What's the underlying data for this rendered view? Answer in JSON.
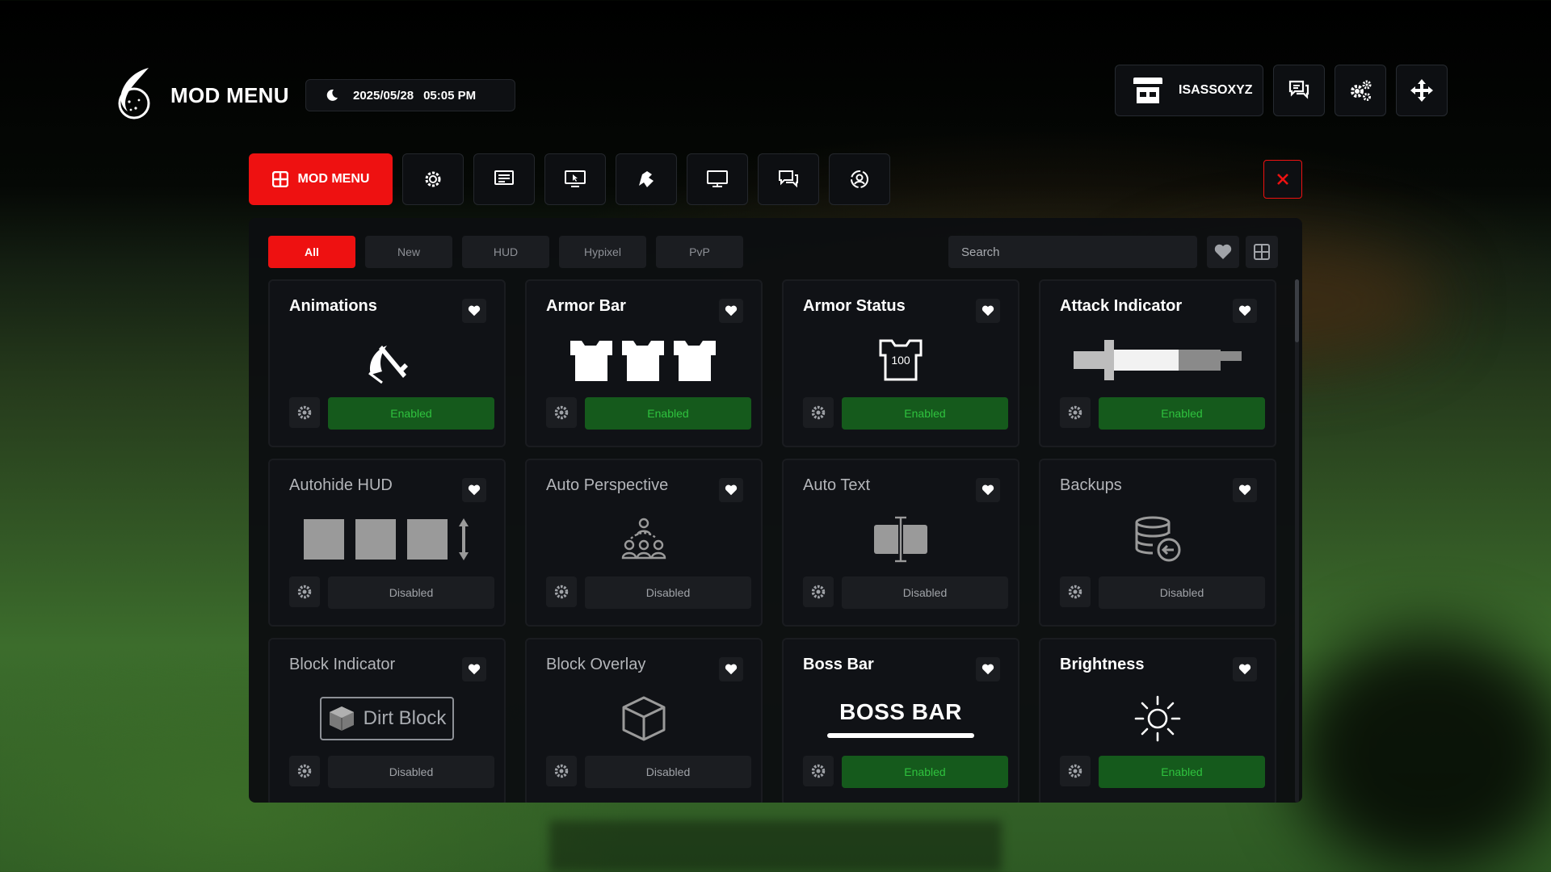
{
  "header": {
    "brand": "MOD MENU",
    "date": "2025/05/28",
    "time": "05:05 PM",
    "username": "ISASSOXYZ"
  },
  "tabs": {
    "main_label": "MOD MENU",
    "icons": [
      "gear-icon",
      "text-icon",
      "screen-mouse-icon",
      "cosmetic-icon",
      "monitor-icon",
      "chat-icon",
      "profile-icon"
    ]
  },
  "filters": [
    "All",
    "New",
    "HUD",
    "Hypixel",
    "PvP"
  ],
  "search": {
    "placeholder": "Search"
  },
  "mods": [
    {
      "name": "Animations",
      "status": "Enabled"
    },
    {
      "name": "Armor Bar",
      "status": "Enabled"
    },
    {
      "name": "Armor Status",
      "status": "Enabled",
      "preview_text": "100"
    },
    {
      "name": "Attack Indicator",
      "status": "Enabled"
    },
    {
      "name": "Autohide HUD",
      "status": "Disabled"
    },
    {
      "name": "Auto Perspective",
      "status": "Disabled"
    },
    {
      "name": "Auto Text",
      "status": "Disabled"
    },
    {
      "name": "Backups",
      "status": "Disabled"
    },
    {
      "name": "Block Indicator",
      "status": "Disabled",
      "preview_text": "Dirt Block"
    },
    {
      "name": "Block Overlay",
      "status": "Disabled"
    },
    {
      "name": "Boss Bar",
      "status": "Enabled",
      "preview_text": "BOSS BAR"
    },
    {
      "name": "Brightness",
      "status": "Enabled"
    }
  ],
  "colors": {
    "accent": "#ee1111",
    "enabled_bg": "#155a1c",
    "enabled_text": "#2fc23e"
  }
}
